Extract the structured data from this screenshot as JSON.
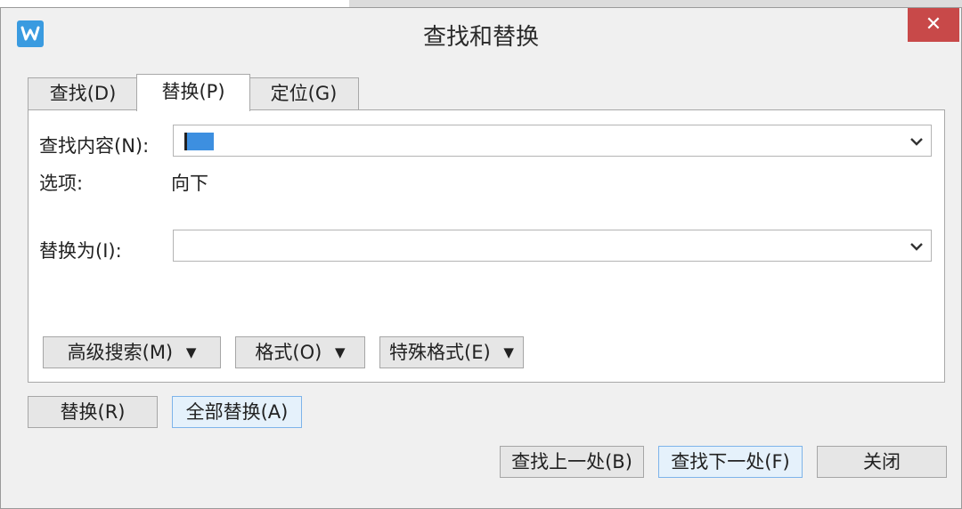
{
  "window": {
    "title": "查找和替换",
    "close_label": "✕",
    "app_icon": "wps-writer-icon"
  },
  "tabs": [
    {
      "label": "查找(D)"
    },
    {
      "label": "替换(P)",
      "active": true
    },
    {
      "label": "定位(G)"
    }
  ],
  "find": {
    "label": "查找内容(N):",
    "value": ""
  },
  "options": {
    "label": "选项:",
    "value": "向下"
  },
  "replace": {
    "label": "替换为(I):",
    "value": ""
  },
  "panel_buttons": {
    "advanced": "高级搜索(M)",
    "advanced_arrow": "▼",
    "format": "格式(O)",
    "format_arrow": "▼",
    "special": "特殊格式(E)",
    "special_arrow": "▼"
  },
  "actions": {
    "replace": "替换(R)",
    "replace_all": "全部替换(A)",
    "find_prev": "查找上一处(B)",
    "find_next": "查找下一处(F)",
    "close": "关闭"
  },
  "colors": {
    "close_bg": "#c84949",
    "selection": "#3d8fe0",
    "icon_bg": "#3a9be0"
  }
}
